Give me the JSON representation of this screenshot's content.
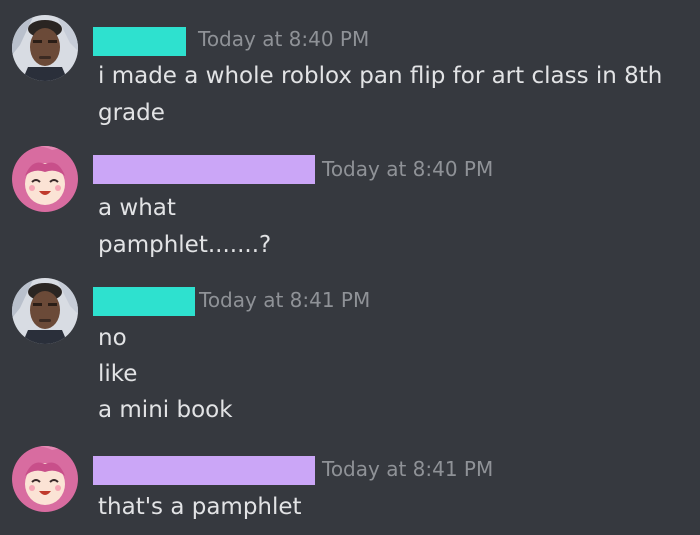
{
  "colors": {
    "background": "#36393f",
    "timestamp": "#8f9297",
    "message_text": "#e2e3e5",
    "user1_redaction": "#2ee1cf",
    "user2_redaction": "#cba6f7"
  },
  "messages": [
    {
      "avatar_icon": "man-portrait-avatar-icon",
      "timestamp": "Today at 8:40 PM",
      "lines": [
        "i made a whole roblox pan flip for art class in 8th",
        "grade"
      ]
    },
    {
      "avatar_icon": "pink-hair-anime-girl-avatar-icon",
      "timestamp": "Today at 8:40 PM",
      "lines": [
        "a what",
        "pamphlet.......?"
      ]
    },
    {
      "avatar_icon": "man-portrait-avatar-icon",
      "timestamp": "Today at 8:41 PM",
      "lines": [
        "no",
        "like",
        "a mini book"
      ]
    },
    {
      "avatar_icon": "pink-hair-anime-girl-avatar-icon",
      "timestamp": "Today at 8:41 PM",
      "lines": [
        "that's a pamphlet"
      ]
    }
  ]
}
